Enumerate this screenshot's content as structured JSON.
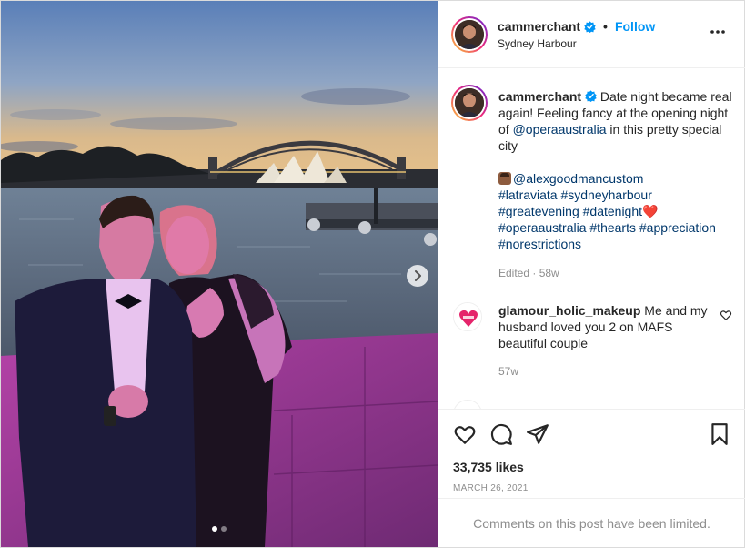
{
  "post": {
    "username": "cammerchant",
    "follow_label": "Follow",
    "separator": "•",
    "location": "Sydney Harbour",
    "caption_text": "Date night became real again! Feeling fancy at the opening night of",
    "caption_mention": "@operaaustralia",
    "caption_tail": "in this pretty special city",
    "tag_mention": "@alexgoodmancustom",
    "hashtags_line1": "#latraviata #sydneyharbour",
    "hashtags_line2": "#greatevening #datenight",
    "hashtags_line3": "#operaaustralia #thearts #appreciation",
    "hashtags_line4": "#norestrictions",
    "heart_emoji": "❤️",
    "caption_meta": "Edited · 58w",
    "likes": "33,735 likes",
    "date": "March 26, 2021",
    "comments_limited": "Comments on this post have been limited."
  },
  "comments": [
    {
      "username": "glamour_holic_makeup",
      "text": "Me and my husband loved you 2 on MAFS beautiful couple",
      "time": "57w"
    }
  ],
  "icons": {
    "verified": "verified-badge-icon",
    "more": "more-options-icon",
    "like": "heart-icon",
    "comment": "comment-icon",
    "share": "share-icon",
    "save": "bookmark-icon",
    "next": "chevron-right-icon"
  },
  "colors": {
    "accent": "#0095f6",
    "link": "#00376b",
    "muted": "#8e8e8e"
  },
  "carousel": {
    "total": 2,
    "current": 1
  }
}
